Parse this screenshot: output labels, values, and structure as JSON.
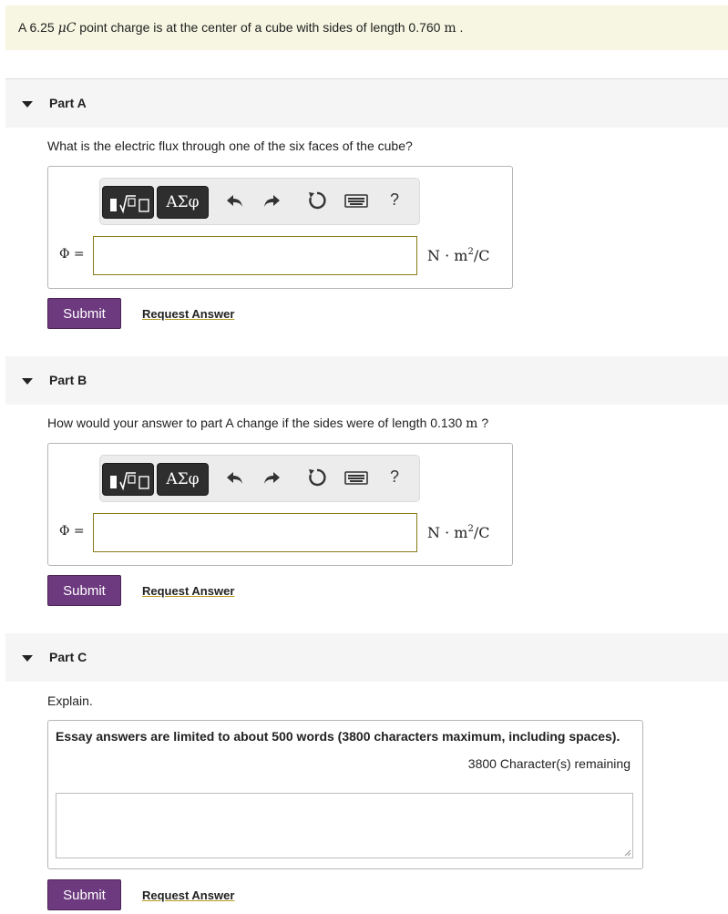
{
  "problem": {
    "intro_prefix": "A 6.25 ",
    "intro_unit": "μC",
    "intro_middle": " point charge is at the center of a cube with sides of length 0.760 ",
    "intro_len_unit": "m",
    "intro_end": " ."
  },
  "toolbar": {
    "greek_label": "ΑΣφ",
    "help_label": "?"
  },
  "parts": [
    {
      "title": "Part A",
      "question": "What is the electric flux through one of the six faces of the cube?",
      "answer_label": "Φ =",
      "answer_value": "",
      "units": {
        "base": "N · m",
        "exp": "2",
        "tail": "/C"
      },
      "submit_label": "Submit",
      "request_label": "Request Answer"
    },
    {
      "title": "Part B",
      "question_prefix": "How would your answer to part A change if the sides were of length 0.130 ",
      "question_unit": "m",
      "question_end": " ?",
      "answer_label": "Φ =",
      "answer_value": "",
      "units": {
        "base": "N · m",
        "exp": "2",
        "tail": "/C"
      },
      "submit_label": "Submit",
      "request_label": "Request Answer"
    },
    {
      "title": "Part C",
      "question": "Explain.",
      "essay_note": "Essay answers are limited to about 500 words (3800 characters maximum, including spaces).",
      "remaining": "3800 Character(s) remaining",
      "essay_value": "",
      "submit_label": "Submit",
      "request_label": "Request Answer"
    }
  ],
  "colors": {
    "intro_bg": "#f6f6e2",
    "submit_bg": "#6d3a7f",
    "input_border": "#8a7a1a",
    "link_underline": "#b59a1e"
  },
  "icons": [
    "caret-down-icon",
    "templates-icon",
    "greek-icon",
    "undo-icon",
    "redo-icon",
    "reset-icon",
    "keyboard-icon",
    "help-icon",
    "resize-grip-icon"
  ]
}
